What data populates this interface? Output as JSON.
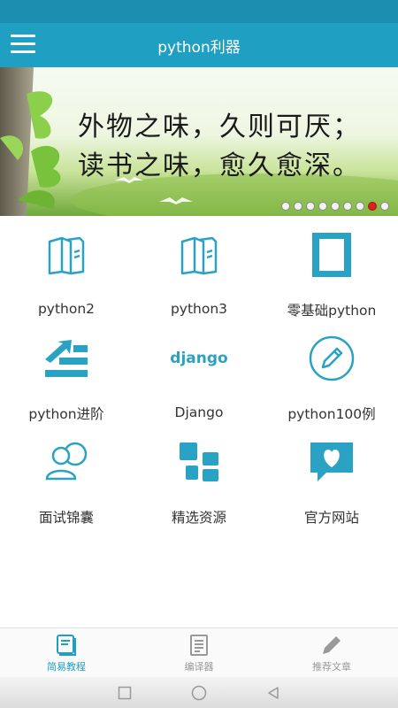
{
  "app_bar": {
    "title": "python利器",
    "menu_icon": "hamburger-menu-icon",
    "background": "#1fa0c3"
  },
  "banner": {
    "line1": "外物之味，久则可厌；",
    "line2": "读书之味，愈久愈深。",
    "slide_count": 9,
    "active_slide": 8
  },
  "grid": [
    {
      "label": "python2",
      "icon": "book-icon"
    },
    {
      "label": "python3",
      "icon": "book-icon"
    },
    {
      "label": "零基础python",
      "icon": "square-frame-icon"
    },
    {
      "label": "python进阶",
      "icon": "advance-arrow-icon"
    },
    {
      "label": "Django",
      "icon": "django-logo-icon",
      "logo_text": "django"
    },
    {
      "label": "python100例",
      "icon": "pencil-circle-icon"
    },
    {
      "label": "面试锦囊",
      "icon": "users-icon"
    },
    {
      "label": "精选资源",
      "icon": "blocks-icon"
    },
    {
      "label": "官方网站",
      "icon": "heart-chat-icon"
    }
  ],
  "bottom_nav": [
    {
      "label": "简易教程",
      "icon": "book-tutorial-icon",
      "active": true
    },
    {
      "label": "编译器",
      "icon": "document-icon",
      "active": false
    },
    {
      "label": "推荐文章",
      "icon": "pencil-icon",
      "active": false
    }
  ],
  "colors": {
    "accent": "#2aa2c4",
    "active_dot": "#d9231e",
    "label": "#333333"
  }
}
